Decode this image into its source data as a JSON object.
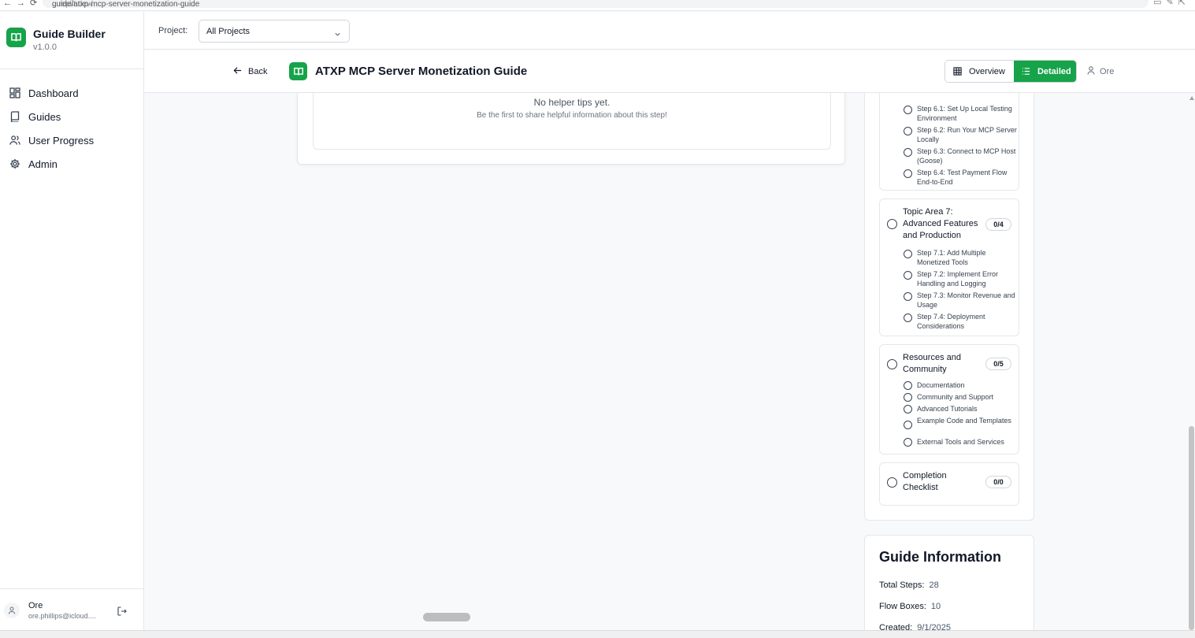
{
  "browser": {
    "url_host": "...replit.dev/",
    "url_path": "guide/atxp-mcp-server-monetization-guide"
  },
  "sidebar": {
    "app_name": "Guide Builder",
    "version": "v1.0.0",
    "items": [
      {
        "label": "Dashboard",
        "icon": "dashboard-icon"
      },
      {
        "label": "Guides",
        "icon": "book-icon"
      },
      {
        "label": "User Progress",
        "icon": "users-icon"
      },
      {
        "label": "Admin",
        "icon": "gear-icon"
      }
    ],
    "user": {
      "name": "Ore",
      "email": "ore.phillips@icloud...."
    }
  },
  "project_bar": {
    "label": "Project:",
    "selected": "All Projects"
  },
  "guide_header": {
    "back_label": "Back",
    "title": "ATXP MCP Server Monetization Guide",
    "view_overview": "Overview",
    "view_detailed": "Detailed",
    "active_view": "Detailed",
    "user": "Ore"
  },
  "helper_tips": {
    "empty_title": "No helper tips yet.",
    "empty_subtitle": "Be the first to share helpful information about this step!"
  },
  "outline": {
    "topics": [
      {
        "title": "",
        "count": "",
        "steps": [
          "Step 6.1: Set Up Local Testing Environment",
          "Step 6.2: Run Your MCP Server Locally",
          "Step 6.3: Connect to MCP Host (Goose)",
          "Step 6.4: Test Payment Flow End-to-End"
        ]
      },
      {
        "title": "Topic Area 7: Advanced Features and Production",
        "count": "0/4",
        "steps": [
          "Step 7.1: Add Multiple Monetized Tools",
          "Step 7.2: Implement Error Handling and Logging",
          "Step 7.3: Monitor Revenue and Usage",
          "Step 7.4: Deployment Considerations"
        ]
      },
      {
        "title": "Resources and Community",
        "count": "0/5",
        "steps": [
          "Documentation",
          "Community and Support",
          "Advanced Tutorials",
          "Example Code and Templates",
          "External Tools and Services"
        ]
      },
      {
        "title": "Completion Checklist",
        "count": "0/0",
        "steps": []
      }
    ]
  },
  "guide_info": {
    "title": "Guide Information",
    "rows": [
      {
        "label": "Total Steps:",
        "value": "28"
      },
      {
        "label": "Flow Boxes:",
        "value": "10"
      },
      {
        "label": "Created:",
        "value": "9/1/2025"
      }
    ]
  },
  "colors": {
    "accent": "#16a34a",
    "border": "#e5e7eb",
    "background": "#f8f9fb"
  }
}
